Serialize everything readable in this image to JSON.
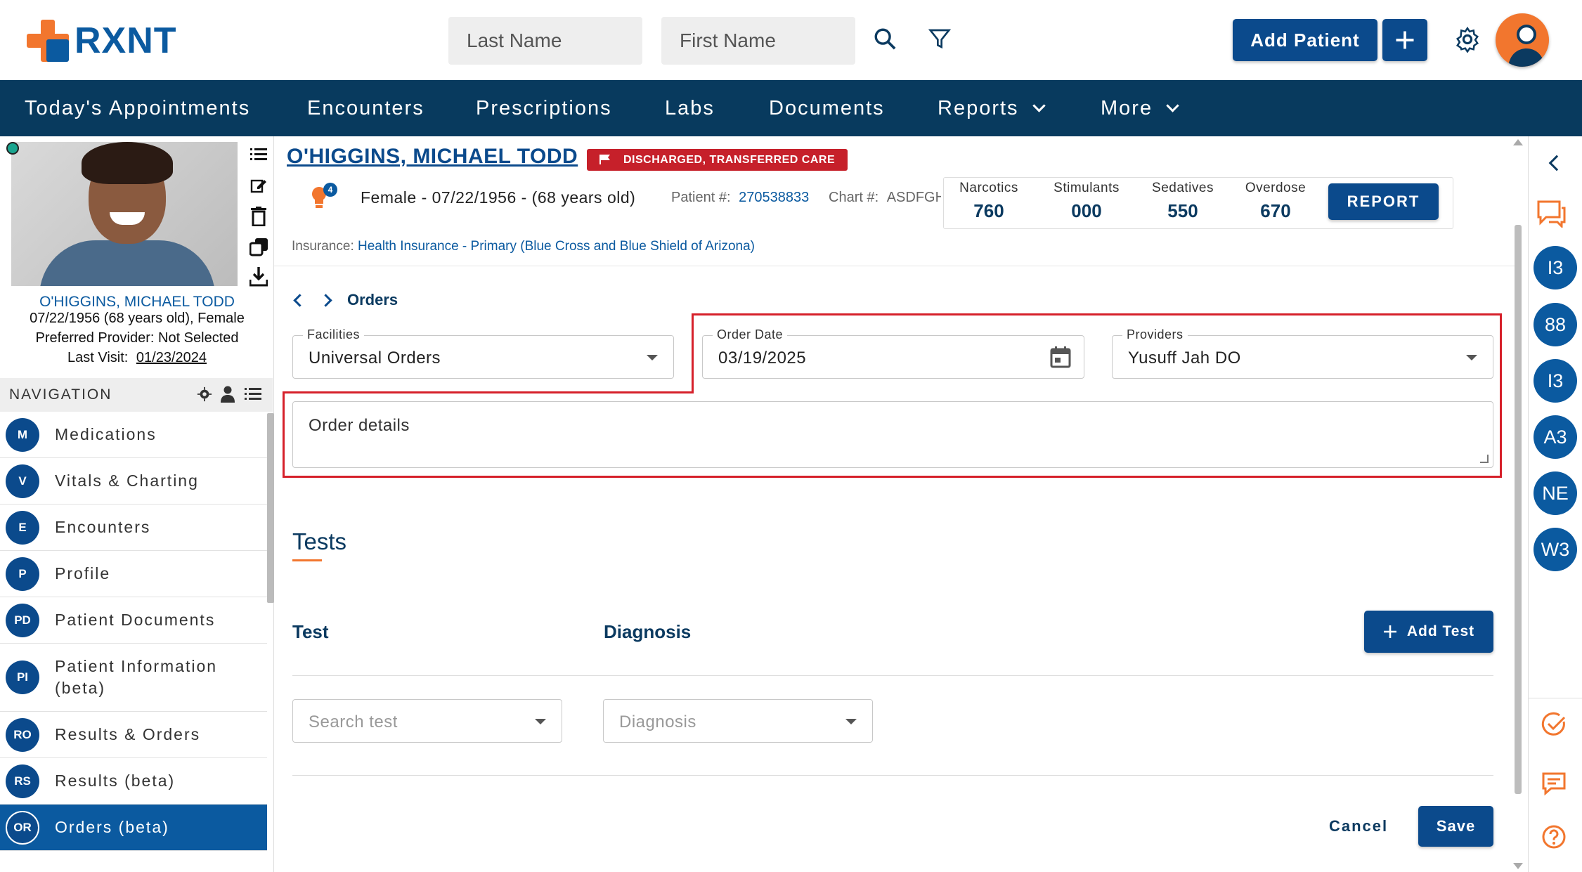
{
  "app": {
    "brand": "RXNT",
    "brand_colors": {
      "orange": "#f2762e",
      "blue": "#0b5aa0",
      "navy": "#083a5e",
      "red": "#c6202a"
    }
  },
  "topbar": {
    "last_name_placeholder": "Last Name",
    "first_name_placeholder": "First Name",
    "add_patient_label": "Add Patient",
    "icons": [
      "search-icon",
      "filter-icon",
      "plus-icon",
      "gear-icon",
      "avatar-icon"
    ]
  },
  "nav": {
    "items": [
      {
        "label": "Today's Appointments"
      },
      {
        "label": "Encounters"
      },
      {
        "label": "Prescriptions"
      },
      {
        "label": "Labs"
      },
      {
        "label": "Documents"
      },
      {
        "label": "Reports",
        "dropdown": true
      },
      {
        "label": "More",
        "dropdown": true
      }
    ]
  },
  "patient_card": {
    "name": "O'HIGGINS, MICHAEL TODD",
    "dob_line": "07/22/1956 (68 years old), Female",
    "provider_line": "Preferred Provider: Not Selected",
    "last_visit_label": "Last Visit:",
    "last_visit_date": "01/23/2024",
    "tools": [
      "list-icon",
      "edit-icon",
      "trash-icon",
      "copy-icon",
      "download-icon"
    ]
  },
  "navigation": {
    "title": "NAVIGATION",
    "items": [
      {
        "abbr": "M",
        "label": "Medications"
      },
      {
        "abbr": "V",
        "label": "Vitals & Charting"
      },
      {
        "abbr": "E",
        "label": "Encounters"
      },
      {
        "abbr": "P",
        "label": "Profile"
      },
      {
        "abbr": "PD",
        "label": "Patient Documents"
      },
      {
        "abbr": "PI",
        "label": "Patient Information (beta)"
      },
      {
        "abbr": "RO",
        "label": "Results & Orders"
      },
      {
        "abbr": "RS",
        "label": "Results (beta)"
      },
      {
        "abbr": "OR",
        "label": "Orders (beta)",
        "active": true
      }
    ]
  },
  "header": {
    "patient_name": "O'HIGGINS, MICHAEL TODD",
    "status_badge": "DISCHARGED, TRANSFERRED CARE",
    "alert_count": "4",
    "demographics": "Female - 07/22/1956 - (68 years old)",
    "patient_no_label": "Patient #:",
    "patient_no": "270538833",
    "chart_label": "Chart #:",
    "chart_no": "ASDFGHI",
    "insurance_label": "Insurance:",
    "insurance_value": "Health Insurance - Primary (Blue Cross and Blue Shield of Arizona)",
    "pdmp": [
      {
        "label": "Narcotics",
        "value": "760"
      },
      {
        "label": "Stimulants",
        "value": "000"
      },
      {
        "label": "Sedatives",
        "value": "550"
      },
      {
        "label": "Overdose",
        "value": "670"
      }
    ],
    "report_label": "REPORT"
  },
  "orders": {
    "breadcrumb": "Orders",
    "facilities_label": "Facilities",
    "facilities_value": "Universal Orders",
    "order_date_label": "Order Date",
    "order_date_value": "03/19/2025",
    "providers_label": "Providers",
    "providers_value": "Yusuff Jah DO",
    "details_placeholder": "Order details",
    "tests_title": "Tests",
    "col_test": "Test",
    "col_diagnosis": "Diagnosis",
    "add_test_label": "Add Test",
    "search_test_placeholder": "Search test",
    "diagnosis_placeholder": "Diagnosis",
    "cancel_label": "Cancel",
    "save_label": "Save"
  },
  "right_rail": {
    "circles": [
      "I3",
      "88",
      "I3",
      "A3",
      "NE",
      "W3"
    ],
    "icons": [
      "chevron-left-icon",
      "chat-bubble-icon",
      "check-circle-icon",
      "message-icon",
      "help-icon"
    ]
  }
}
